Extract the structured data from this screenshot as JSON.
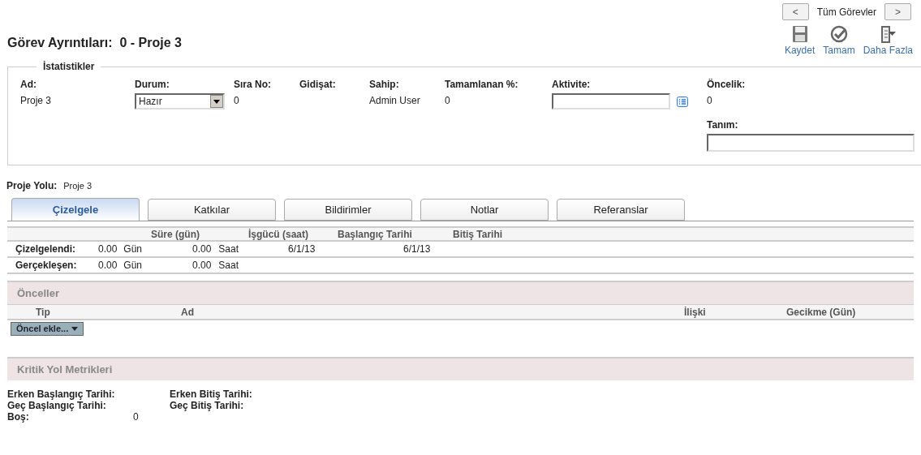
{
  "nav": {
    "prev": "<",
    "label": "Tüm Görevler",
    "next": ">"
  },
  "title": "Görev Ayrıntıları:  0 - Proje 3",
  "toolbar": [
    {
      "kind": "save",
      "label": "Kaydet"
    },
    {
      "kind": "done",
      "label": "Tamam"
    },
    {
      "kind": "more",
      "label": "Daha Fazla"
    }
  ],
  "stats": {
    "legend": "İstatistikler",
    "fields": [
      {
        "kind": "text",
        "label": "Ad:",
        "value": "Proje 3"
      },
      {
        "kind": "select",
        "label": "Durum:",
        "value": "Hazır"
      },
      {
        "kind": "text",
        "label": "Sıra No:",
        "value": "0"
      },
      {
        "kind": "text",
        "label": "Gidişat:"
      },
      {
        "kind": "text",
        "label": "Sahip:",
        "value": "Admin User"
      },
      {
        "kind": "text",
        "label": "Tamamlanan %:",
        "value": "0"
      },
      {
        "kind": "lookup",
        "label": "Aktivite:"
      }
    ],
    "side": [
      {
        "kind": "text",
        "label": "Öncelik:",
        "value": "0"
      },
      {
        "kind": "input",
        "label": "Tanım:"
      }
    ]
  },
  "project_path": {
    "label": "Proje Yolu:",
    "value": "Proje 3"
  },
  "tabs": [
    {
      "label": "Çizelgele",
      "selected": true
    },
    {
      "label": "Katkılar",
      "selected": false
    },
    {
      "label": "Bildirimler",
      "selected": false
    },
    {
      "label": "Notlar",
      "selected": false
    },
    {
      "label": "Referanslar",
      "selected": false
    }
  ],
  "schedule": {
    "columns": [
      "Süre (gün)",
      "İşgücü (saat)",
      "Başlangıç Tarihi",
      "Bitiş Tarihi"
    ],
    "rows": [
      {
        "label": "Çizelgelendi:",
        "duration": "0.00",
        "duration_unit": "Gün",
        "effort": "0.00",
        "effort_unit": "Saat",
        "start": "6/1/13",
        "end": "6/1/13"
      },
      {
        "label": "Gerçekleşen:",
        "duration": "0.00",
        "duration_unit": "Gün",
        "effort": "0.00",
        "effort_unit": "Saat"
      }
    ]
  },
  "predecessors": {
    "title": "Önceller",
    "columns": [
      "Tip",
      "Ad",
      "İlişki",
      "Gecikme (Gün)"
    ],
    "add_button": "Öncel ekle..."
  },
  "critical_path": {
    "title": "Kritik Yol Metrikleri",
    "items": [
      {
        "label": "Erken Başlangıç Tarihi:"
      },
      {
        "label": "Erken Bitiş Tarihi:"
      },
      {
        "label": "Geç Başlangıç Tarihi:"
      },
      {
        "label": "Geç Bitiş Tarihi:"
      },
      {
        "label": "Boş:",
        "value": "0"
      }
    ]
  }
}
